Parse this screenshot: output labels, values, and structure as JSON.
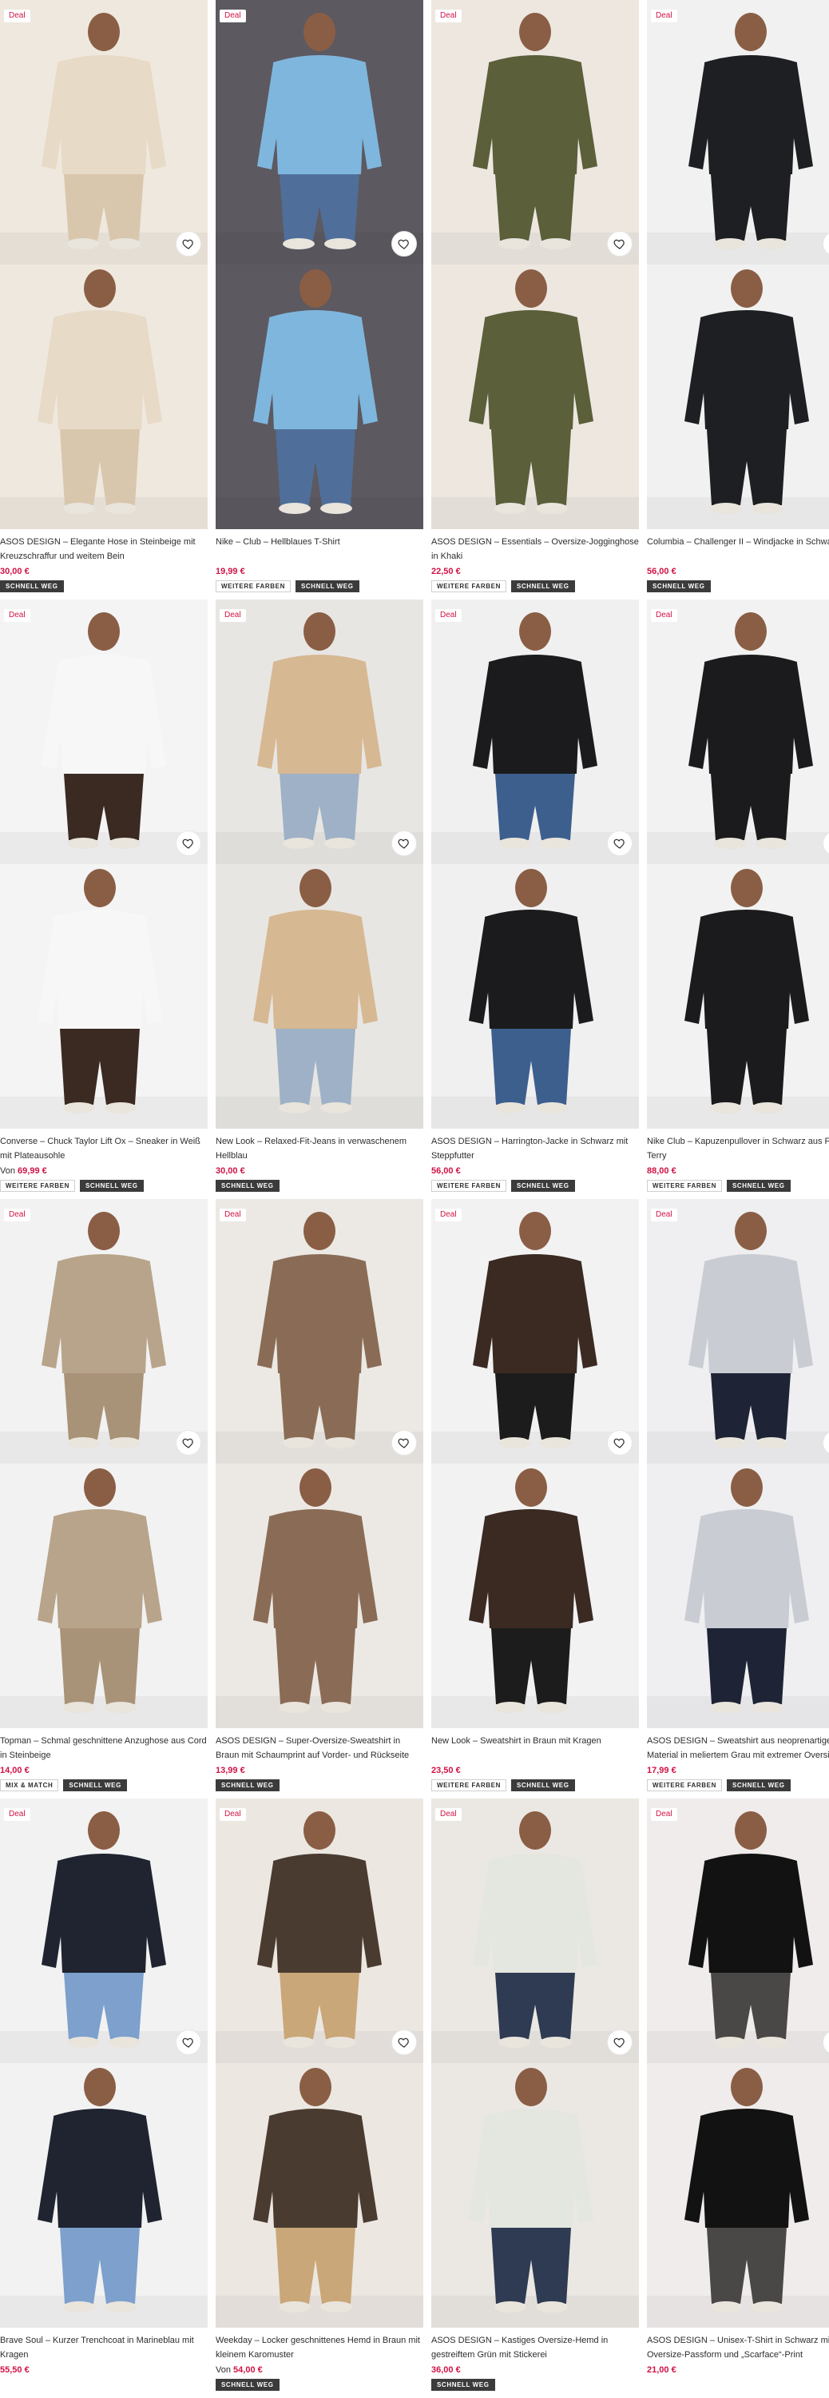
{
  "deal_label": "Deal",
  "products": [
    {
      "title": "ASOS DESIGN – Elegante Hose in Steinbeige mit Kreuzschraffur und weitem Bein",
      "price": "30,00 €",
      "price_prefix": "",
      "badges": [
        {
          "label": "SCHNELL WEG",
          "dark": true
        }
      ],
      "deal": true,
      "palette": {
        "bg": "#efe8de",
        "top": "#e7dac6",
        "bottom": "#d9c7ad"
      }
    },
    {
      "title": "Nike – Club – Hellblaues T-Shirt",
      "price": "19,99 €",
      "price_prefix": "",
      "badges": [
        {
          "label": "WEITERE FARBEN",
          "dark": false
        },
        {
          "label": "SCHNELL WEG",
          "dark": true
        }
      ],
      "deal": true,
      "palette": {
        "bg": "#5d5960",
        "top": "#7fb6dd",
        "bottom": "#4f6f9a"
      }
    },
    {
      "title": "ASOS DESIGN – Essentials – Oversize-Jogginghose in Khaki",
      "price": "22,50 €",
      "price_prefix": "",
      "badges": [
        {
          "label": "WEITERE FARBEN",
          "dark": false
        },
        {
          "label": "SCHNELL WEG",
          "dark": true
        }
      ],
      "deal": true,
      "palette": {
        "bg": "#ede7e0",
        "top": "#5b5f3a",
        "bottom": "#5b5f3a"
      }
    },
    {
      "title": "Columbia – Challenger II – Windjacke in Schwarz",
      "price": "56,00 €",
      "price_prefix": "",
      "badges": [
        {
          "label": "SCHNELL WEG",
          "dark": true
        }
      ],
      "deal": true,
      "palette": {
        "bg": "#f1f1f1",
        "top": "#1d1f22",
        "bottom": "#1d1f22"
      }
    },
    {
      "title": "Converse – Chuck Taylor Lift Ox – Sneaker in Weiß mit Plateausohle",
      "price": "69,99 €",
      "price_prefix": "Von",
      "badges": [
        {
          "label": "WEITERE FARBEN",
          "dark": false
        },
        {
          "label": "SCHNELL WEG",
          "dark": true
        }
      ],
      "deal": true,
      "palette": {
        "bg": "#f4f4f4",
        "top": "#f7f7f7",
        "bottom": "#3a2a22"
      }
    },
    {
      "title": "New Look – Relaxed-Fit-Jeans in verwaschenem Hellblau",
      "price": "30,00 €",
      "price_prefix": "",
      "badges": [
        {
          "label": "SCHNELL WEG",
          "dark": true
        }
      ],
      "deal": true,
      "palette": {
        "bg": "#e8e6e3",
        "top": "#d6b892",
        "bottom": "#9fb1c6"
      }
    },
    {
      "title": "ASOS DESIGN – Harrington-Jacke in Schwarz mit Steppfutter",
      "price": "56,00 €",
      "price_prefix": "",
      "badges": [
        {
          "label": "WEITERE FARBEN",
          "dark": false
        },
        {
          "label": "SCHNELL WEG",
          "dark": true
        }
      ],
      "deal": true,
      "palette": {
        "bg": "#f0f0f0",
        "top": "#1b1b1d",
        "bottom": "#3d5f8e"
      }
    },
    {
      "title": "Nike Club – Kapuzenpullover in Schwarz aus French Terry",
      "price": "88,00 €",
      "price_prefix": "",
      "badges": [
        {
          "label": "WEITERE FARBEN",
          "dark": false
        },
        {
          "label": "SCHNELL WEG",
          "dark": true
        }
      ],
      "deal": true,
      "palette": {
        "bg": "#f2f2f2",
        "top": "#1b1b1d",
        "bottom": "#1b1b1d"
      }
    },
    {
      "title": "Topman – Schmal geschnittene Anzughose aus Cord in Steinbeige",
      "price": "14,00 €",
      "price_prefix": "",
      "badges": [
        {
          "label": "MIX & MATCH",
          "dark": false
        },
        {
          "label": "SCHNELL WEG",
          "dark": true
        }
      ],
      "deal": true,
      "palette": {
        "bg": "#f2f2f2",
        "top": "#b8a48a",
        "bottom": "#a99378"
      }
    },
    {
      "title": "ASOS DESIGN – Super-Oversize-Sweatshirt in Braun mit Schaumprint auf Vorder- und Rückseite",
      "price": "13,99 €",
      "price_prefix": "",
      "badges": [
        {
          "label": "SCHNELL WEG",
          "dark": true
        }
      ],
      "deal": true,
      "palette": {
        "bg": "#ece9e4",
        "top": "#8a6c56",
        "bottom": "#8a6c56"
      }
    },
    {
      "title": "New Look – Sweatshirt in Braun mit Kragen",
      "price": "23,50 €",
      "price_prefix": "",
      "badges": [
        {
          "label": "WEITERE FARBEN",
          "dark": false
        },
        {
          "label": "SCHNELL WEG",
          "dark": true
        }
      ],
      "deal": true,
      "palette": {
        "bg": "#f2f2f2",
        "top": "#3a2a22",
        "bottom": "#1c1c1c"
      }
    },
    {
      "title": "ASOS DESIGN – Sweatshirt aus neoprenartigem Material in meliertem Grau mit extremer Oversize-Passform",
      "price": "17,99 €",
      "price_prefix": "",
      "badges": [
        {
          "label": "WEITERE FARBEN",
          "dark": false
        },
        {
          "label": "SCHNELL WEG",
          "dark": true
        }
      ],
      "deal": true,
      "palette": {
        "bg": "#efeff1",
        "top": "#c9ccd3",
        "bottom": "#1e2436"
      }
    },
    {
      "title": "Brave Soul – Kurzer Trenchcoat in Marineblau mit Kragen",
      "price": "55,50 €",
      "price_prefix": "",
      "badges": [],
      "deal": true,
      "palette": {
        "bg": "#f2f2f2",
        "top": "#1f2430",
        "bottom": "#7da0cc"
      }
    },
    {
      "title": "Weekday – Locker geschnittenes Hemd in Braun mit kleinem Karomuster",
      "price": "54,00 €",
      "price_prefix": "Von",
      "badges": [
        {
          "label": "SCHNELL WEG",
          "dark": true
        }
      ],
      "deal": true,
      "palette": {
        "bg": "#ece7e1",
        "top": "#4a3b31",
        "bottom": "#c9a778"
      }
    },
    {
      "title": "ASOS DESIGN – Kastiges Oversize-Hemd in gestreiftem Grün mit Stickerei",
      "price": "36,00 €",
      "price_prefix": "",
      "badges": [
        {
          "label": "SCHNELL WEG",
          "dark": true
        }
      ],
      "deal": true,
      "palette": {
        "bg": "#ebe8e3",
        "top": "#e4e6e0",
        "bottom": "#2e3b52"
      }
    },
    {
      "title": "ASOS DESIGN – Unisex-T-Shirt in Schwarz mit Oversize-Passform und „Scarface“-Print",
      "price": "21,00 €",
      "price_prefix": "",
      "badges": [],
      "deal": true,
      "palette": {
        "bg": "#efeceb",
        "top": "#121212",
        "bottom": "#4a4846"
      }
    }
  ]
}
